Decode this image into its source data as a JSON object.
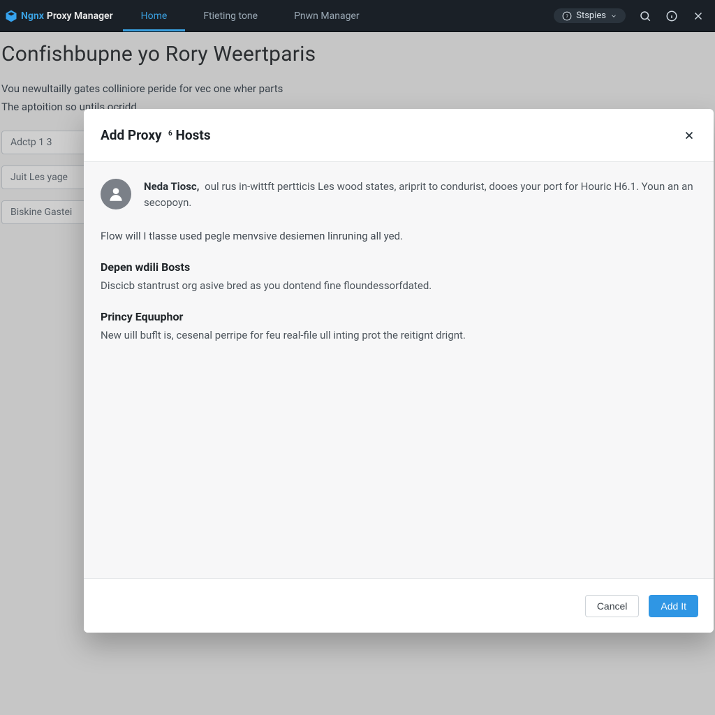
{
  "navbar": {
    "brand_part1": "Ngnx",
    "brand_part2": "Proxy Manager",
    "tabs": [
      {
        "label": "Home"
      },
      {
        "label": "Ftieting tone"
      },
      {
        "label": "Pnwn Manager"
      }
    ],
    "pill_label": "Stspies",
    "icons": {
      "search": "search-icon",
      "info": "info-icon",
      "close": "close-icon",
      "help": "help-icon"
    }
  },
  "page": {
    "title": "Confishbupne yo Rory Weertparis",
    "intro1": "Vou newultailly gates colliniore peride for vec one wher parts",
    "intro2": "The aptoition so untils ocridd",
    "cards": [
      {
        "label": "Adctp 1       3"
      },
      {
        "label": "Juit Les yage"
      },
      {
        "label": "Biskine Gastei"
      }
    ]
  },
  "modal": {
    "title": "Add Proxy",
    "title_sup": "6",
    "title_after": "Hosts",
    "intro_bold": "Neda Tiosc,",
    "intro_text_1": "oul rus in-wittft pertticis Les wood states, ariprit to condurist, dooes your port for Houric H6.1. Youn an an secopoyn.",
    "lead": "Flow will I tlasse used pegle menvsive desiemen linruning all yed.",
    "sections": [
      {
        "heading": "Depen wdili Bosts",
        "body": "Discicb stantrust org asive bred as you dontend fine floundessorfdated."
      },
      {
        "heading": "Princy Equuphor",
        "body": "New uill buflt is, cesenal perripe for feu real-file ull inting prot the reitignt drignt."
      }
    ],
    "cancel_label": "Cancel",
    "submit_label": "Add It"
  }
}
